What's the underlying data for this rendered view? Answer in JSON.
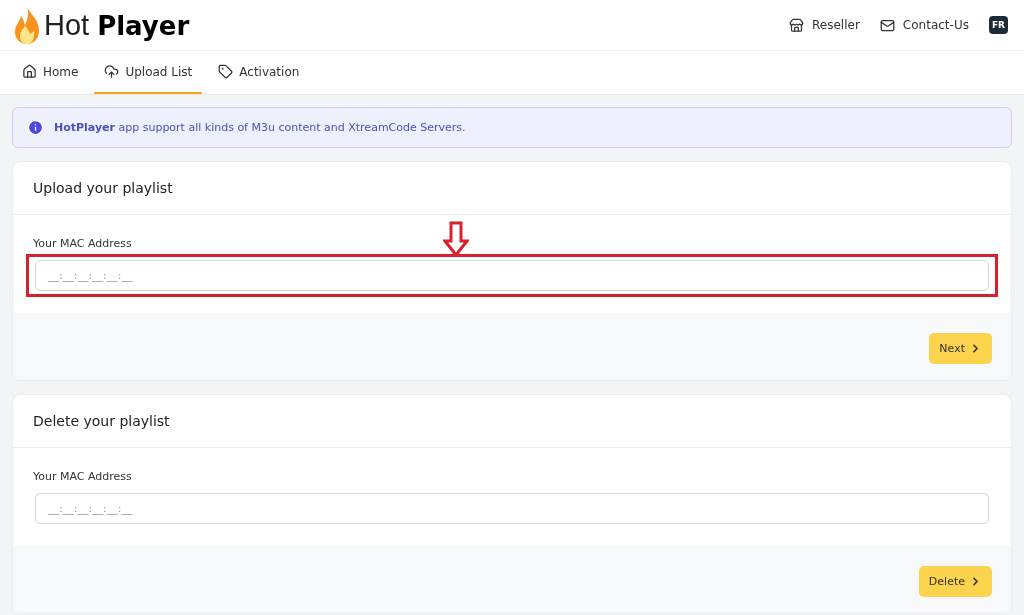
{
  "logo": {
    "light": "Hot",
    "bold": "Player"
  },
  "header_links": [
    {
      "kind": "store",
      "label": "Reseller"
    },
    {
      "kind": "mail",
      "label": "Contact-Us"
    }
  ],
  "language": "FR",
  "tabs": [
    {
      "kind": "home",
      "label": "Home",
      "selected": false
    },
    {
      "kind": "upload",
      "label": "Upload List",
      "selected": true
    },
    {
      "kind": "tag",
      "label": "Activation",
      "selected": false
    }
  ],
  "alert": "**HotPlayer** app support all kinds of M3u content and XtreamCode Servers.",
  "cards": [
    {
      "title": "Upload your playlist",
      "field_label": "Your MAC Address",
      "placeholder": "__:__:__:__:__:__",
      "highlighted": true,
      "button": "Next"
    },
    {
      "title": "Delete your playlist",
      "field_label": "Your MAC Address",
      "placeholder": "__:__:__:__:__:__",
      "highlighted": false,
      "button": "Delete"
    }
  ]
}
